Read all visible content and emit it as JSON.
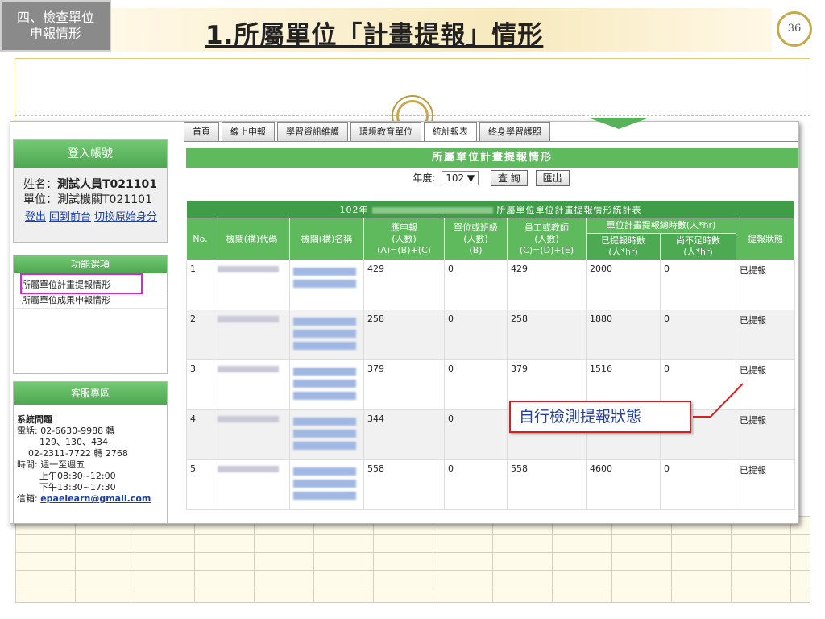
{
  "slide": {
    "section_tag": "四、檢查單位\n申報情形",
    "title": "1.所屬單位「計畫提報」情形",
    "page_number": "36"
  },
  "nav": {
    "tabs": [
      "首頁",
      "線上申報",
      "學習資訊維護",
      "環境教育單位",
      "統計報表",
      "終身學習護照"
    ]
  },
  "sidebar": {
    "login_header": "登入帳號",
    "name_label": "姓名：",
    "name_value": "測試人員T021101",
    "unit_label": "單位：",
    "unit_value": "測試機關T021101",
    "links": [
      "登出",
      "回到前台",
      "切換原始身分"
    ],
    "func_header": "功能選項",
    "func_items": [
      "所屬單位計畫提報情形",
      "所屬單位成果申報情形"
    ],
    "service_header": "客服專區",
    "service": {
      "title": "系統問題",
      "phone_line1": "電話: 02-6630-9988 轉",
      "phone_line2": "129、130、434",
      "phone_line3": "02-2311-7722 轉 2768",
      "hours_line1": "時間: 週一至週五",
      "hours_line2": "上午08:30~12:00",
      "hours_line3": "下午13:30~17:30",
      "email_label": "信箱: ",
      "email": "epaelearn@gmail.com"
    }
  },
  "main": {
    "header": "所屬單位計畫提報情形",
    "year_label": "年度:",
    "year_value": "102 ▼",
    "query_btn": "查 詢",
    "export_btn": "匯出",
    "table_caption_pre": "102年",
    "table_caption_post": "所屬單位單位計畫提報情形統計表",
    "columns": {
      "no": "No.",
      "code": "機關(構)代碼",
      "name": "機關(構)名稱",
      "should": "應申報\n(人數)\n(A)=(B)+(C)",
      "unit_level": "單位或班級\n(人數)\n(B)",
      "staff": "員工或教師\n(人數)\n(C)=(D)+(E)",
      "hours_group": "單位計畫提報總時數(人*hr)",
      "reported_hours": "已提報時數\n(人*hr)",
      "lack_hours": "尚不足時數\n(人*hr)",
      "status": "提報狀態"
    },
    "rows": [
      {
        "no": "1",
        "a": "429",
        "b": "0",
        "c": "429",
        "d": "2000",
        "e": "0",
        "status": "已提報"
      },
      {
        "no": "2",
        "a": "258",
        "b": "0",
        "c": "258",
        "d": "1880",
        "e": "0",
        "status": "已提報"
      },
      {
        "no": "3",
        "a": "379",
        "b": "0",
        "c": "379",
        "d": "1516",
        "e": "0",
        "status": "已提報"
      },
      {
        "no": "4",
        "a": "344",
        "b": "0",
        "c": "",
        "d": "",
        "e": "",
        "status": "已提報"
      },
      {
        "no": "5",
        "a": "558",
        "b": "0",
        "c": "558",
        "d": "4600",
        "e": "0",
        "status": "已提報"
      }
    ]
  },
  "callout": {
    "text": "自行檢測提報狀態",
    "border_color": "#d42020",
    "text_color": "#2540a0"
  },
  "colors": {
    "accent_green": "#5fba5e",
    "highlight_magenta": "#e020e0",
    "gold": "#c9a84a"
  }
}
